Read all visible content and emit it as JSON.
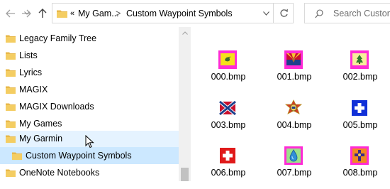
{
  "toolbar": {
    "back_icon": "arrow-left-icon",
    "forward_icon": "chevron-down-icon",
    "up_icon": "arrow-up-icon"
  },
  "address_bar": {
    "overflow": "«",
    "crumbs": [
      "My Gam...",
      "Custom Waypoint Symbols"
    ],
    "separator": ">"
  },
  "search": {
    "placeholder": "Search Custom"
  },
  "nav": {
    "items": [
      {
        "label": "Legacy Family Tree",
        "state": "normal"
      },
      {
        "label": "Lists",
        "state": "normal"
      },
      {
        "label": "Lyrics",
        "state": "normal"
      },
      {
        "label": "MAGIX",
        "state": "normal"
      },
      {
        "label": "MAGIX Downloads",
        "state": "normal"
      },
      {
        "label": "My Games",
        "state": "normal"
      },
      {
        "label": "My Garmin",
        "state": "hover"
      },
      {
        "label": "Custom Waypoint Symbols",
        "state": "selected"
      },
      {
        "label": "OneNote Notebooks",
        "state": "normal"
      }
    ]
  },
  "files": [
    {
      "name": "000.bmp",
      "icon": "yellow-flag-icon"
    },
    {
      "name": "001.bmp",
      "icon": "arizona-flag-icon"
    },
    {
      "name": "002.bmp",
      "icon": "tree-flag-icon"
    },
    {
      "name": "003.bmp",
      "icon": "confederate-flag-icon"
    },
    {
      "name": "004.bmp",
      "icon": "vfw-emblem-icon"
    },
    {
      "name": "005.bmp",
      "icon": "blue-cross-icon"
    },
    {
      "name": "006.bmp",
      "icon": "red-cross-icon"
    },
    {
      "name": "007.bmp",
      "icon": "water-drop-icon"
    },
    {
      "name": "008.bmp",
      "icon": "orange-cross-icon"
    }
  ],
  "colors": {
    "folder": "#e8b84a",
    "hover": "#e5f3ff",
    "selected": "#cce8ff"
  }
}
